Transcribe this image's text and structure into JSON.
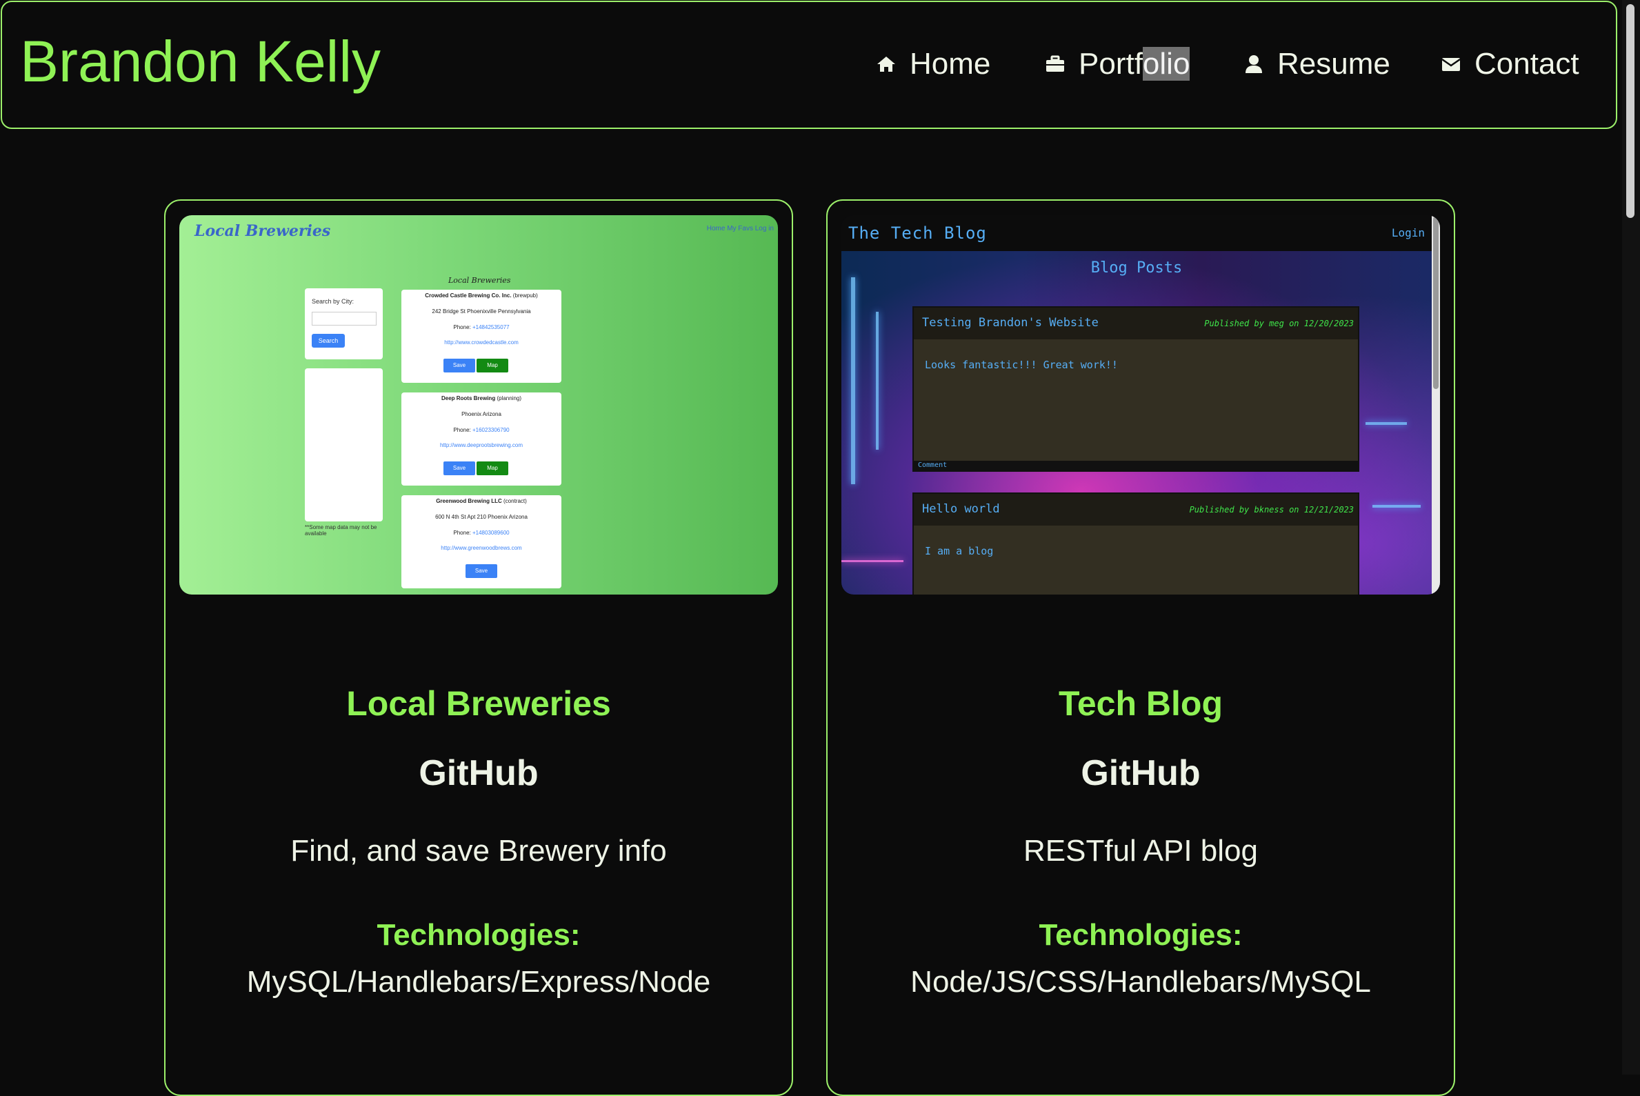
{
  "header": {
    "brand": "Brandon Kelly",
    "nav": [
      {
        "label": "Home",
        "icon": "home-icon"
      },
      {
        "label_part1": "Portf",
        "label_part2": "olio",
        "icon": "briefcase-icon"
      },
      {
        "label": "Resume",
        "icon": "user-icon"
      },
      {
        "label": "Contact",
        "icon": "envelope-icon"
      }
    ]
  },
  "colors": {
    "accent": "#8ff255",
    "border": "#9cf06a",
    "background": "#0b0b0b",
    "text": "#eef3e6"
  },
  "projects": [
    {
      "title": "Local Breweries",
      "github": "GitHub",
      "description": "Find, and save Brewery info",
      "tech_heading": "Technologies:",
      "technologies": "MySQL/Handlebars/Express/Node",
      "screenshot": {
        "logo": "Local Breweries",
        "top_links": "Home  My Favs  Log in",
        "heading": "Local Breweries",
        "search_label": "Search by City:",
        "search_button": "Search",
        "map_note": "**Some map data may not be available",
        "entries": [
          {
            "name": "Crowded Castle Brewing Co. Inc.",
            "type": "(brewpub)",
            "address": "242 Bridge St Phoenixville Pennsylvania",
            "phone_label": "Phone:",
            "phone": "+14842535077",
            "url": "http://www.crowdedcastle.com",
            "save": "Save",
            "map": "Map"
          },
          {
            "name": "Deep Roots Brewing",
            "type": "(planning)",
            "address": "Phoenix Arizona",
            "phone_label": "Phone:",
            "phone": "+16023306790",
            "url": "http://www.deeprootsbrewing.com",
            "save": "Save",
            "map": "Map"
          },
          {
            "name": "Greenwood Brewing LLC",
            "type": "(contract)",
            "address": "600 N 4th St Apt 210 Phoenix Arizona",
            "phone_label": "Phone:",
            "phone": "+14803089600",
            "url": "http://www.greenwoodbrews.com",
            "save": "Save"
          }
        ]
      }
    },
    {
      "title": "Tech Blog",
      "github": "GitHub",
      "description": "RESTful API blog",
      "tech_heading": "Technologies:",
      "technologies": "Node/JS/CSS/Handlebars/MySQL",
      "screenshot": {
        "site_title": "The Tech Blog",
        "login": "Login",
        "posts_heading": "Blog Posts",
        "posts": [
          {
            "title": "Testing Brandon's Website",
            "meta": "Published by meg on 12/20/2023",
            "body": "Looks fantastic!!! Great work!!",
            "footer": "Comment"
          },
          {
            "title": "Hello world",
            "meta": "Published by bkness on 12/21/2023",
            "body": "I am a blog"
          }
        ]
      }
    }
  ]
}
